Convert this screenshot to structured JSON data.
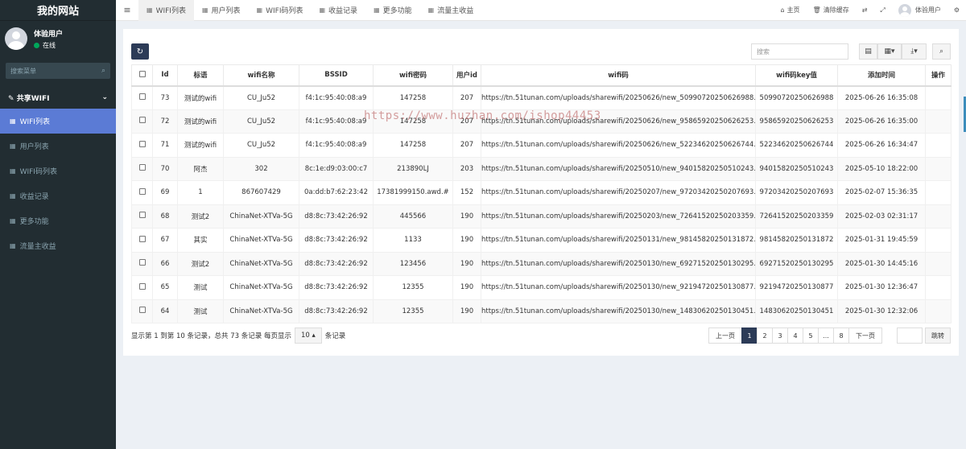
{
  "brand": "我的网站",
  "user": {
    "name": "体验用户",
    "status": "在线"
  },
  "sidebar": {
    "search_placeholder": "搜索菜单",
    "group": "共享WIFI",
    "items": [
      {
        "label": "WIFI列表",
        "active": true
      },
      {
        "label": "用户列表"
      },
      {
        "label": "WIFI码列表"
      },
      {
        "label": "收益记录"
      },
      {
        "label": "更多功能"
      },
      {
        "label": "流量主收益"
      }
    ]
  },
  "topnav": {
    "tabs": [
      "WIFI列表",
      "用户列表",
      "WIFI码列表",
      "收益记录",
      "更多功能",
      "流量主收益"
    ],
    "home": "主页",
    "clear_cache": "清除缓存",
    "user": "体验用户"
  },
  "toolbar": {
    "search_placeholder": "搜索"
  },
  "table": {
    "headers": [
      "Id",
      "标语",
      "wifi名称",
      "BSSID",
      "wifi密码",
      "用户id",
      "wifi码",
      "wifi码key值",
      "添加时间",
      "操作"
    ],
    "rows": [
      [
        "73",
        "测试的wifi",
        "CU_Ju52",
        "f4:1c:95:40:08:a9",
        "147258",
        "207",
        "https://tn.51tunan.com/uploads/sharewifi/20250626/new_50990720250626988.png",
        "50990720250626988",
        "2025-06-26 16:35:08"
      ],
      [
        "72",
        "测试的wifi",
        "CU_Ju52",
        "f4:1c:95:40:08:a9",
        "147258",
        "207",
        "https://tn.51tunan.com/uploads/sharewifi/20250626/new_95865920250626253.png",
        "95865920250626253",
        "2025-06-26 16:35:00"
      ],
      [
        "71",
        "测试的wifi",
        "CU_Ju52",
        "f4:1c:95:40:08:a9",
        "147258",
        "207",
        "https://tn.51tunan.com/uploads/sharewifi/20250626/new_52234620250626744.png",
        "52234620250626744",
        "2025-06-26 16:34:47"
      ],
      [
        "70",
        "阿杰",
        "302",
        "8c:1e:d9:03:00:c7",
        "213890LJ",
        "203",
        "https://tn.51tunan.com/uploads/sharewifi/20250510/new_94015820250510243.png",
        "94015820250510243",
        "2025-05-10 18:22:00"
      ],
      [
        "69",
        "1",
        "867607429",
        "0a:dd:b7:62:23:42",
        "17381999150.awd.#",
        "152",
        "https://tn.51tunan.com/uploads/sharewifi/20250207/new_97203420250207693.png",
        "97203420250207693",
        "2025-02-07 15:36:35"
      ],
      [
        "68",
        "测试2",
        "ChinaNet-XTVa-5G",
        "d8:8c:73:42:26:92",
        "445566",
        "190",
        "https://tn.51tunan.com/uploads/sharewifi/20250203/new_72641520250203359.png",
        "72641520250203359",
        "2025-02-03 02:31:17"
      ],
      [
        "67",
        "其实",
        "ChinaNet-XTVa-5G",
        "d8:8c:73:42:26:92",
        "1133",
        "190",
        "https://tn.51tunan.com/uploads/sharewifi/20250131/new_98145820250131872.png",
        "98145820250131872",
        "2025-01-31 19:45:59"
      ],
      [
        "66",
        "测试2",
        "ChinaNet-XTVa-5G",
        "d8:8c:73:42:26:92",
        "123456",
        "190",
        "https://tn.51tunan.com/uploads/sharewifi/20250130/new_69271520250130295.png",
        "69271520250130295",
        "2025-01-30 14:45:16"
      ],
      [
        "65",
        "测试",
        "ChinaNet-XTVa-5G",
        "d8:8c:73:42:26:92",
        "12355",
        "190",
        "https://tn.51tunan.com/uploads/sharewifi/20250130/new_92194720250130877.png",
        "92194720250130877",
        "2025-01-30 12:36:47"
      ],
      [
        "64",
        "测试",
        "ChinaNet-XTVa-5G",
        "d8:8c:73:42:26:92",
        "12355",
        "190",
        "https://tn.51tunan.com/uploads/sharewifi/20250130/new_14830620250130451.png",
        "14830620250130451",
        "2025-01-30 12:32:06"
      ]
    ]
  },
  "footer": {
    "info_prefix": "显示第 1 到第 10 条记录，总共 73 条记录 每页显示",
    "page_size": "10",
    "info_suffix": "条记录"
  },
  "pagination": {
    "prev": "上一页",
    "pages": [
      "1",
      "2",
      "3",
      "4",
      "5",
      "...",
      "8"
    ],
    "active": "1",
    "next": "下一页",
    "jump": "跳转"
  },
  "watermark": "https://www.huzhan.com/ishop44453",
  "colors": {
    "sidebar": "#222d32",
    "accent": "#5b7bd5",
    "primary_btn": "#2c3b57",
    "online": "#00a65a"
  }
}
